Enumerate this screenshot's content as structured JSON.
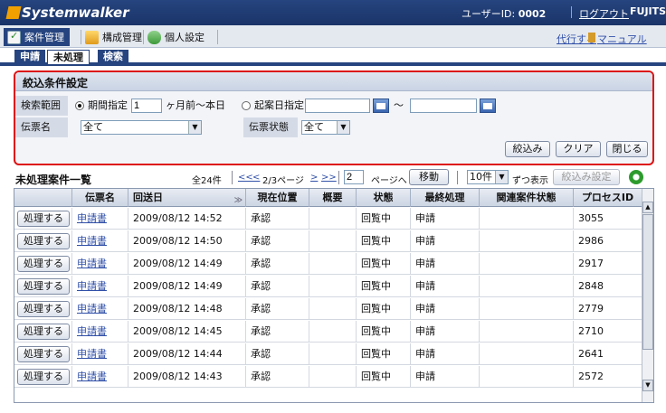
{
  "app": {
    "brand": "Systemwalker",
    "vendor": "FUJITSU"
  },
  "header": {
    "user_label": "ユーザーID:",
    "user_id": "0002",
    "logout": "ログアウト"
  },
  "menu": {
    "items": [
      {
        "label": "案件管理",
        "icon": "case-management-icon"
      },
      {
        "label": "構成管理",
        "icon": "configuration-icon"
      },
      {
        "label": "個人設定",
        "icon": "personal-settings-icon"
      }
    ],
    "proxy": "代行する",
    "manual": "マニュアル"
  },
  "tabs": [
    "申請",
    "未処理",
    "検索"
  ],
  "filter": {
    "title": "絞込条件設定",
    "range_label": "検索範囲",
    "period_radio": "期間指定",
    "period_value": "1",
    "period_suffix": "ヶ月前～本日",
    "date_radio": "起案日指定",
    "date_from": "",
    "tilde": "～",
    "date_to": "",
    "form_label": "伝票名",
    "form_value": "全て",
    "status_label": "伝票状態",
    "status_value": "全て",
    "btn_filter": "絞込み",
    "btn_clear": "クリア",
    "btn_close": "閉じる"
  },
  "list": {
    "title": "未処理案件一覧",
    "total": "全24件",
    "first": "<<",
    "prev": "<",
    "page_info": "2/3ページ",
    "next": ">",
    "last": ">>",
    "page_input": "2",
    "page_suffix": "ページへ",
    "move_btn": "移動",
    "per_page": "10件",
    "per_page_suffix": "ずつ表示",
    "narrow_btn": "絞込み設定",
    "refresh_icon": "refresh-icon"
  },
  "table": {
    "columns": [
      "",
      "伝票名",
      "回送日",
      "現在位置",
      "概要",
      "状態",
      "最終処理",
      "関連案件状態",
      "プロセスID"
    ],
    "action_label": "処理する",
    "rows": [
      {
        "form": "申請書",
        "date": "2009/08/12 14:52",
        "position": "承認",
        "summary": "",
        "status": "回覧中",
        "last": "申請",
        "related": "",
        "pid": "3055"
      },
      {
        "form": "申請書",
        "date": "2009/08/12 14:50",
        "position": "承認",
        "summary": "",
        "status": "回覧中",
        "last": "申請",
        "related": "",
        "pid": "2986"
      },
      {
        "form": "申請書",
        "date": "2009/08/12 14:49",
        "position": "承認",
        "summary": "",
        "status": "回覧中",
        "last": "申請",
        "related": "",
        "pid": "2917"
      },
      {
        "form": "申請書",
        "date": "2009/08/12 14:49",
        "position": "承認",
        "summary": "",
        "status": "回覧中",
        "last": "申請",
        "related": "",
        "pid": "2848"
      },
      {
        "form": "申請書",
        "date": "2009/08/12 14:48",
        "position": "承認",
        "summary": "",
        "status": "回覧中",
        "last": "申請",
        "related": "",
        "pid": "2779"
      },
      {
        "form": "申請書",
        "date": "2009/08/12 14:45",
        "position": "承認",
        "summary": "",
        "status": "回覧中",
        "last": "申請",
        "related": "",
        "pid": "2710"
      },
      {
        "form": "申請書",
        "date": "2009/08/12 14:44",
        "position": "承認",
        "summary": "",
        "status": "回覧中",
        "last": "申請",
        "related": "",
        "pid": "2641"
      },
      {
        "form": "申請書",
        "date": "2009/08/12 14:43",
        "position": "承認",
        "summary": "",
        "status": "回覧中",
        "last": "申請",
        "related": "",
        "pid": "2572"
      }
    ]
  },
  "colors": {
    "header": "#26447f",
    "highlight_border": "#dd1111",
    "link": "#3150a8"
  }
}
